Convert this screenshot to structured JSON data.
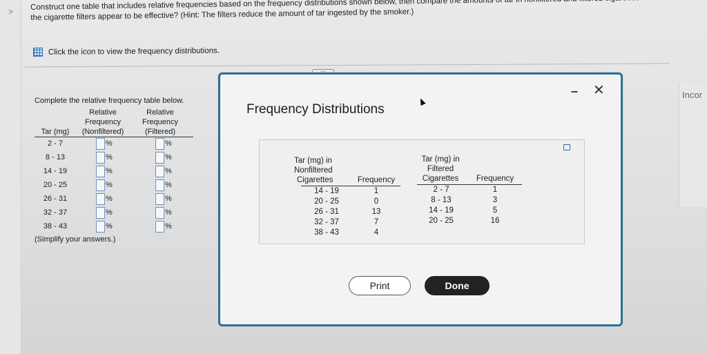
{
  "nav": {
    "back_chevron": ">"
  },
  "instructions": {
    "question": "Construct one table that includes relative frequencies based on the frequency distributions shown below, then compare the amounts of tar in nonfiltered and filtered cigarettes. Do the cigarette filters appear to be effective? (Hint: The filters reduce the amount of tar ingested by the smoker.)",
    "icon_prompt": "Click the icon to view the frequency distributions."
  },
  "side_label": "Incor",
  "ellipsis": "•••",
  "answer_table": {
    "title": "Complete the relative frequency table below.",
    "col_tar": "Tar (mg)",
    "col_nonfiltered": [
      "Relative",
      "Frequency",
      "(Nonfiltered)"
    ],
    "col_filtered": [
      "Relative",
      "Frequency",
      "(Filtered)"
    ],
    "percent": "%",
    "rows": [
      "2 - 7",
      "8 - 13",
      "14 - 19",
      "20 - 25",
      "26 - 31",
      "32 - 37",
      "38 - 43"
    ],
    "note": "(Simplify your answers.)"
  },
  "modal": {
    "title": "Frequency Distributions",
    "minimize": "–",
    "close": "✕",
    "nonfiltered": {
      "header": [
        "Tar (mg) in",
        "Nonfiltered",
        "Cigarettes"
      ],
      "freq_header": "Frequency",
      "classes": [
        "14 - 19",
        "20 - 25",
        "26 - 31",
        "32 - 37",
        "38 - 43"
      ],
      "frequencies": [
        "1",
        "0",
        "13",
        "7",
        "4"
      ]
    },
    "filtered": {
      "header": [
        "Tar (mg) in",
        "Filtered",
        "Cigarettes"
      ],
      "freq_header": "Frequency",
      "classes": [
        "2 - 7",
        "8 - 13",
        "14 - 19",
        "20 - 25"
      ],
      "frequencies": [
        "1",
        "3",
        "5",
        "16"
      ]
    },
    "print_label": "Print",
    "done_label": "Done"
  },
  "colors": {
    "modal_border": "#2f6e91",
    "done_button": "#222222",
    "input_border": "#6c8fc0"
  }
}
